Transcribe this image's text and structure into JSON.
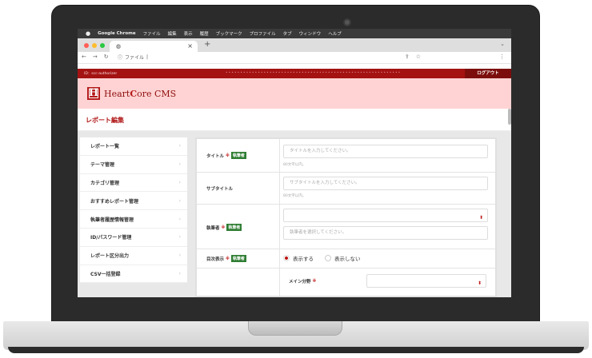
{
  "menubar": {
    "app": "Google Chrome",
    "items": [
      "ファイル",
      "編集",
      "表示",
      "履歴",
      "ブックマーク",
      "プロファイル",
      "タブ",
      "ウィンドウ",
      "ヘルプ"
    ]
  },
  "browser": {
    "tab_close": "×",
    "new_tab": "+",
    "url_label": "ファイル"
  },
  "site": {
    "topstrip_id": "ID：scc-authorizer",
    "logout_label": "ログアウト",
    "brand_name_prefix": "Heart",
    "brand_name_mid": "C",
    "brand_name_suffix": "ore CMS",
    "brand_mark": "H",
    "page_title": "レポート編集"
  },
  "sidebar": {
    "items": [
      {
        "label": "レポート一覧"
      },
      {
        "label": "テーマ管理"
      },
      {
        "label": "カテゴリ管理"
      },
      {
        "label": "おすすめレポート管理"
      },
      {
        "label": "執筆者履歴情報管理"
      },
      {
        "label": "ID/パスワード管理"
      },
      {
        "label": "レポート区分出力"
      },
      {
        "label": "CSV一括登録"
      }
    ]
  },
  "form": {
    "required_mark": "※",
    "badge_label": "執筆者",
    "title": {
      "label": "タイトル",
      "placeholder": "タイトルを入力してください。",
      "hint": "80文字以内。"
    },
    "subtitle": {
      "label": "サブタイトル",
      "placeholder": "サブタイトルを入力してください。",
      "hint": "80文字以内。"
    },
    "author": {
      "label": "執筆者",
      "placeholder": "執筆者を選択してください。"
    },
    "toc": {
      "label": "目次表示",
      "option_show": "表示する",
      "option_hide": "表示しない"
    },
    "main_category": {
      "label": "メイン分野"
    }
  }
}
